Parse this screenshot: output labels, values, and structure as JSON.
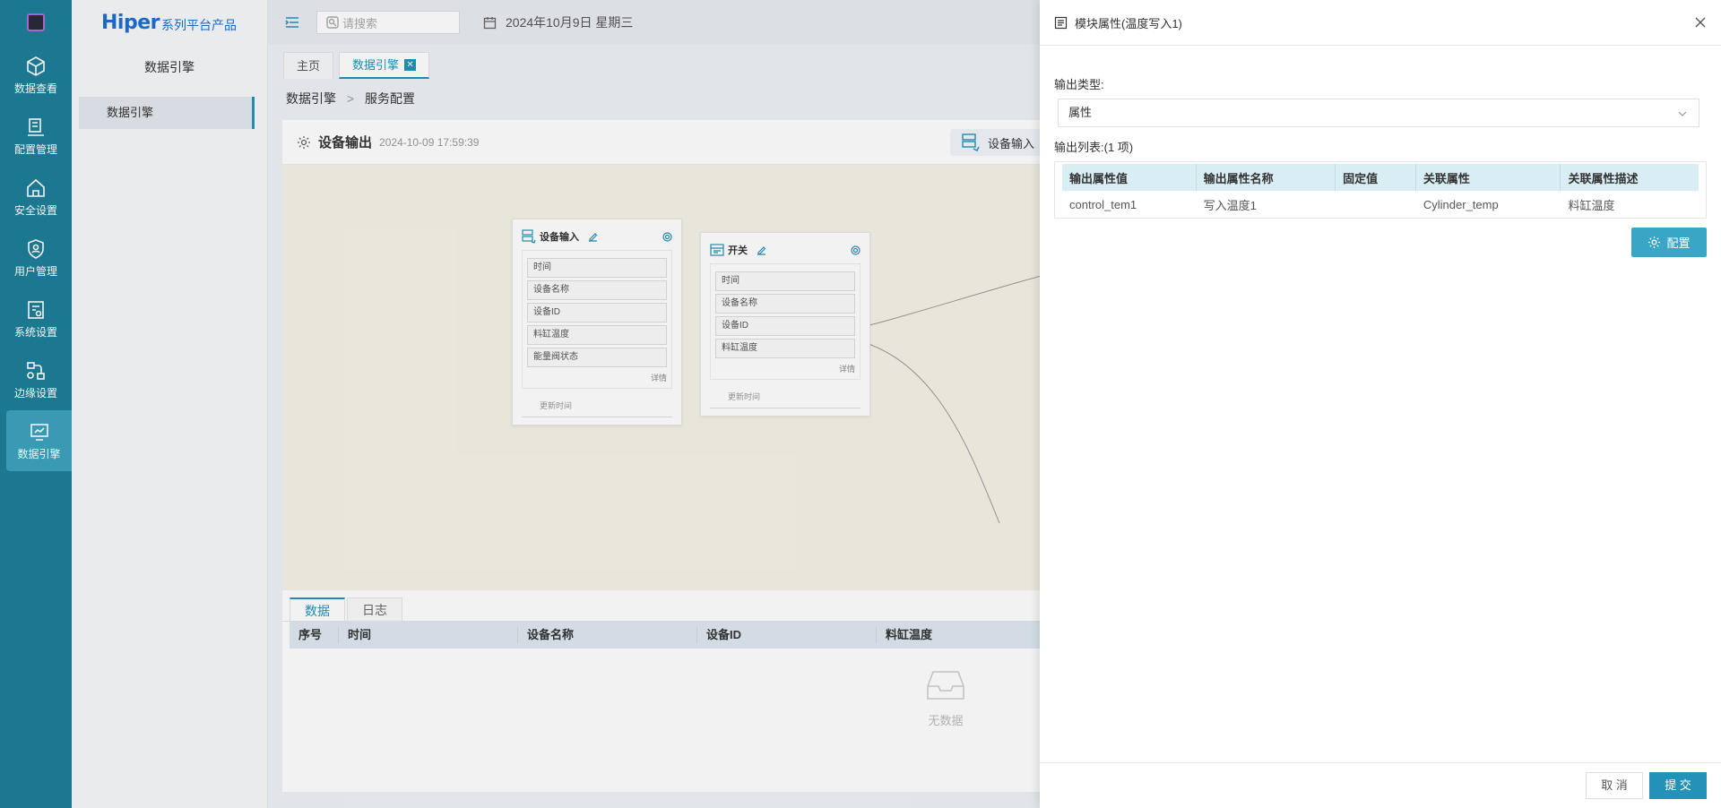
{
  "rail": {
    "items": [
      {
        "label": "数据查看",
        "icon": "cube-icon"
      },
      {
        "label": "配置管理",
        "icon": "config-icon"
      },
      {
        "label": "安全设置",
        "icon": "security-home-icon"
      },
      {
        "label": "用户管理",
        "icon": "user-shield-icon"
      },
      {
        "label": "系统设置",
        "icon": "system-settings-icon"
      },
      {
        "label": "边缘设置",
        "icon": "edge-flow-icon"
      },
      {
        "label": "数据引擎",
        "icon": "data-engine-icon"
      }
    ],
    "active_index": 6
  },
  "brand": {
    "name": "Hiper",
    "suffix": "系列平台产品"
  },
  "sub_sidebar": {
    "title": "数据引擎",
    "items": [
      "数据引擎"
    ]
  },
  "topbar": {
    "search_placeholder": "请搜索",
    "date": "2024年10月9日 星期三"
  },
  "tabs": [
    {
      "label": "主页"
    },
    {
      "label": "数据引擎"
    }
  ],
  "breadcrumb": {
    "items": [
      "数据引擎",
      "服务配置"
    ],
    "separator": ">"
  },
  "panel": {
    "title": "设备输出",
    "timestamp": "2024-10-09 17:59:39",
    "device_input_button": "设备输入"
  },
  "nodes": {
    "device_input": {
      "title": "设备输入",
      "fields": [
        "时间",
        "设备名称",
        "设备ID",
        "料缸温度",
        "能量阀状态"
      ],
      "more": "详情",
      "footer": "更新时间"
    },
    "switch": {
      "title": "开关",
      "fields": [
        "时间",
        "设备名称",
        "设备ID",
        "料缸温度"
      ],
      "more": "详情",
      "footer": "更新时间"
    }
  },
  "data_area": {
    "tabs": [
      "数据",
      "日志"
    ],
    "columns": [
      "序号",
      "时间",
      "设备名称",
      "设备ID",
      "料缸温度"
    ],
    "empty_text": "无数据"
  },
  "drawer": {
    "title": "模块属性(温度写入1)",
    "output_type_label": "输出类型:",
    "output_type_value": "属性",
    "output_list_label": "输出列表:(1 项)",
    "table": {
      "columns": [
        "输出属性值",
        "输出属性名称",
        "固定值",
        "关联属性",
        "关联属性描述"
      ],
      "rows": [
        [
          "control_tem1",
          "写入温度1",
          "",
          "Cylinder_temp",
          "料缸温度"
        ]
      ]
    },
    "config_button": "配置",
    "cancel_button": "取 消",
    "submit_button": "提 交"
  },
  "colors": {
    "rail": "#1e7f98",
    "accent": "#2392b8",
    "config_button": "#3aa6c6"
  }
}
